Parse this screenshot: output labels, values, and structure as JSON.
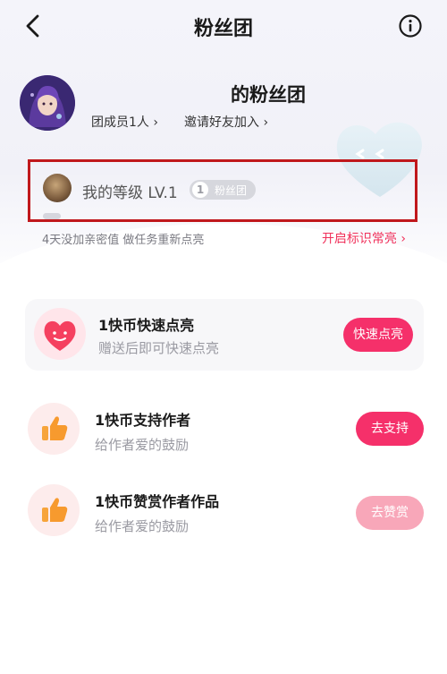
{
  "nav": {
    "title": "粉丝团"
  },
  "header": {
    "group_name": "的粉丝团",
    "members_link": "团成员1人 ›",
    "invite_link": "邀请好友加入 ›"
  },
  "level": {
    "label": "我的等级 LV.1",
    "badge_number": "1",
    "badge_text": "粉丝团",
    "progress": 0.0,
    "warning": "4天没加亲密值 做任务重新点亮",
    "enable_link": "开启标识常亮 ›"
  },
  "tasks": [
    {
      "title": "1快币快速点亮",
      "subtitle": "赠送后即可快速点亮",
      "button": "快速点亮",
      "button_color": "#f5306a"
    },
    {
      "title": "1快币支持作者",
      "subtitle": "给作者爱的鼓励",
      "button": "去支持",
      "button_color": "#f5306a"
    },
    {
      "title": "1快币赞赏作者作品",
      "subtitle": "给作者爱的鼓励",
      "button": "去赞赏",
      "button_color": "#f8a7b9"
    }
  ],
  "colors": {
    "accent": "#f5306a",
    "highlight_border": "#c0181c",
    "link": "#f0305a"
  },
  "icons": [
    "back-arrow-icon",
    "info-icon",
    "heart-smile-icon",
    "thumbs-up-icon"
  ]
}
